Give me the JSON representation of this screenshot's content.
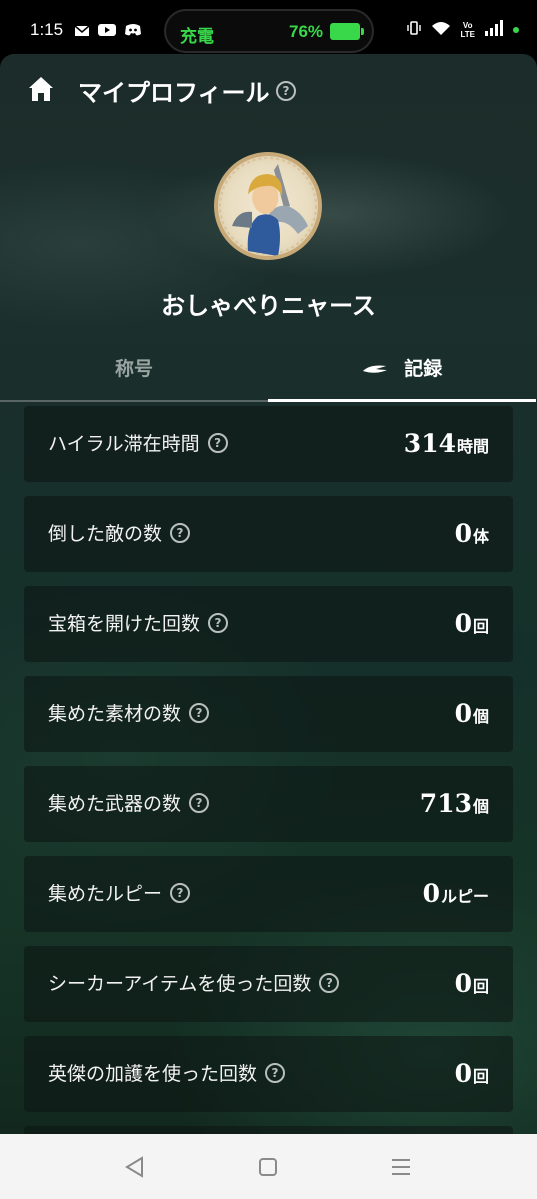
{
  "status_bar": {
    "time": "1:15",
    "charging_label": "充電",
    "battery_percent": "76%",
    "battery_color": "#38d84a",
    "volte_top": "Vo",
    "volte_bottom": "LTE",
    "notification_icons": [
      "mail-icon",
      "youtube-icon",
      "discord-icon"
    ],
    "system_icons": [
      "vibrate-icon",
      "wifi-icon",
      "signal-icon"
    ]
  },
  "header": {
    "title": "マイプロフィール",
    "help_glyph": "?"
  },
  "profile": {
    "name": "おしゃべりニャース"
  },
  "tabs": [
    {
      "label": "称号",
      "active": false
    },
    {
      "label": "記録",
      "active": true
    }
  ],
  "records": [
    {
      "label": "ハイラル滞在時間",
      "value": "314",
      "unit": "時間",
      "help": "?"
    },
    {
      "label": "倒した敵の数",
      "value": "0",
      "unit": "体",
      "help": "?"
    },
    {
      "label": "宝箱を開けた回数",
      "value": "0",
      "unit": "回",
      "help": "?"
    },
    {
      "label": "集めた素材の数",
      "value": "0",
      "unit": "個",
      "help": "?"
    },
    {
      "label": "集めた武器の数",
      "value": "713",
      "unit": "個",
      "help": "?"
    },
    {
      "label": "集めたルピー",
      "value": "0",
      "unit": "ルピー",
      "help": "?"
    },
    {
      "label": "シーカーアイテムを使った回数",
      "value": "0",
      "unit": "回",
      "help": "?"
    },
    {
      "label": "英傑の加護を使った回数",
      "value": "0",
      "unit": "回",
      "help": "?"
    }
  ],
  "navbar": {
    "buttons": [
      "back-icon",
      "home-square-icon",
      "recents-icon"
    ]
  }
}
